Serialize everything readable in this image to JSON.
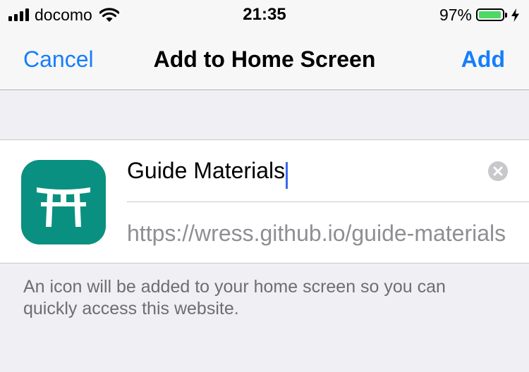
{
  "status_bar": {
    "carrier": "docomo",
    "time": "21:35",
    "battery_percent": "97%",
    "battery_level": 0.97,
    "icons": [
      "signal-bars-icon",
      "wifi-icon",
      "battery-icon",
      "charging-bolt-icon"
    ]
  },
  "nav": {
    "cancel_label": "Cancel",
    "title": "Add to Home Screen",
    "add_label": "Add"
  },
  "bookmark": {
    "icon": "torii-gate-icon",
    "name_value": "Guide Materials",
    "url": "https://wress.github.io/guide-materials"
  },
  "footnote": "An icon will be added to your home screen so you can quickly access this website.",
  "colors": {
    "accent": "#157efb",
    "icon_background": "#0a9080",
    "caret": "#3d66f5",
    "battery_fill": "#4cd964",
    "page_background": "#efeff4"
  }
}
